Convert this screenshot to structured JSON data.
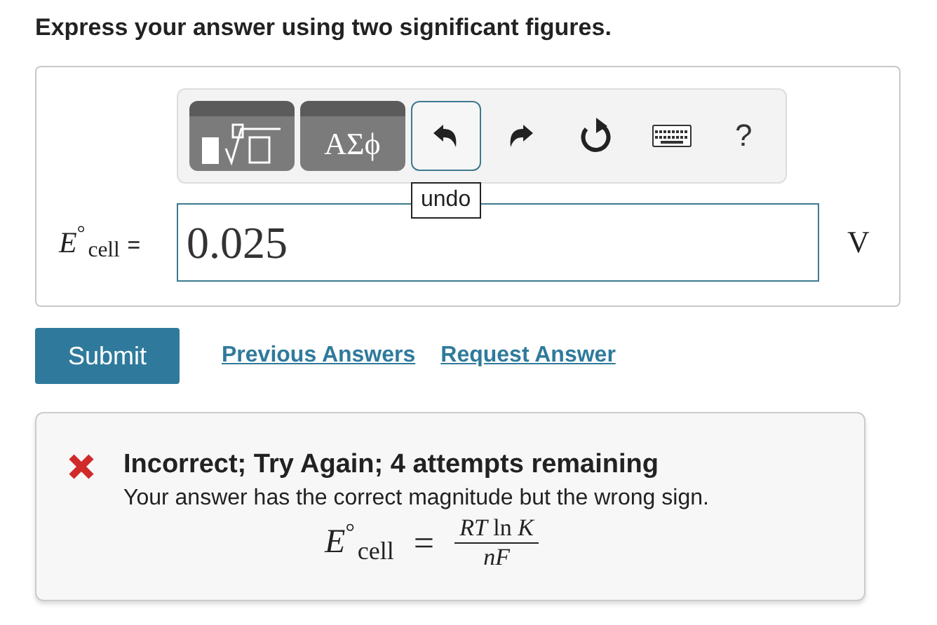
{
  "instruction": "Express your answer using two significant figures.",
  "toolbar": [
    {
      "kind": "template",
      "selected": false
    },
    {
      "kind": "greek",
      "label": "ΑΣϕ",
      "selected": false
    },
    {
      "kind": "undo",
      "selected": true,
      "tooltip": "undo"
    },
    {
      "kind": "redo",
      "selected": false
    },
    {
      "kind": "reset",
      "selected": false
    },
    {
      "kind": "keyboard",
      "selected": false
    },
    {
      "kind": "help",
      "label": "?",
      "selected": false
    }
  ],
  "answer": {
    "symbol": "E",
    "degree": "°",
    "subscript": "cell",
    "equals": "=",
    "value": "0.025",
    "unit": "V"
  },
  "actions": {
    "submit": "Submit",
    "links": [
      "Previous Answers",
      "Request Answer"
    ]
  },
  "feedback": {
    "correct": false,
    "title": "Incorrect; Try Again; 4 attempts remaining",
    "message": "Your answer has the correct magnitude but the wrong sign.",
    "formula": {
      "symbol": "E",
      "degree": "°",
      "subscript": "cell",
      "equals": "=",
      "numerator": "*RT* ln *K*",
      "denominator": "nF"
    }
  }
}
